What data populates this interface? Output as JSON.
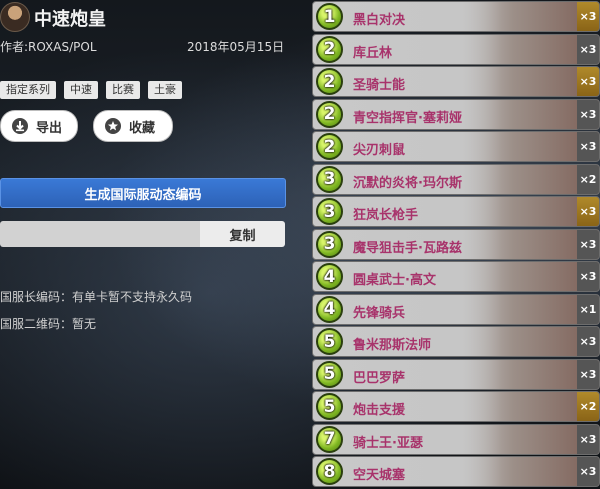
{
  "deck": {
    "title": "中速炮皇",
    "author": "作者:ROXAS/POL",
    "date": "2018年05月15日",
    "tags": [
      "指定系列",
      "中速",
      "比赛",
      "土豪"
    ]
  },
  "actions": {
    "export_label": "导出",
    "favorite_label": "收藏",
    "generate_label": "生成国际服动态编码",
    "copy_label": "复制",
    "code_value": ""
  },
  "notes": {
    "national_code": "国服长编码：有单卡暂不支持永久码",
    "qr_code": "国服二维码：暂无"
  },
  "cards": [
    {
      "cost": "1",
      "name": "黑白对决",
      "count": "×3",
      "gold": true
    },
    {
      "cost": "2",
      "name": "库丘林",
      "count": "×3",
      "gold": false
    },
    {
      "cost": "2",
      "name": "圣骑士能",
      "count": "×3",
      "gold": true
    },
    {
      "cost": "2",
      "name": "青空指挥官·塞莉娅",
      "count": "×3",
      "gold": false
    },
    {
      "cost": "2",
      "name": "尖刃刺鼠",
      "count": "×3",
      "gold": false
    },
    {
      "cost": "3",
      "name": "沉默的炎将·玛尔斯",
      "count": "×2",
      "gold": false
    },
    {
      "cost": "3",
      "name": "狂岚长枪手",
      "count": "×3",
      "gold": true
    },
    {
      "cost": "3",
      "name": "魔导狙击手·瓦路兹",
      "count": "×3",
      "gold": false
    },
    {
      "cost": "4",
      "name": "圆桌武士·高文",
      "count": "×3",
      "gold": false
    },
    {
      "cost": "4",
      "name": "先锋骑兵",
      "count": "×1",
      "gold": false
    },
    {
      "cost": "5",
      "name": "鲁米那斯法师",
      "count": "×3",
      "gold": false
    },
    {
      "cost": "5",
      "name": "巴巴罗萨",
      "count": "×3",
      "gold": false
    },
    {
      "cost": "5",
      "name": "炮击支援",
      "count": "×2",
      "gold": true
    },
    {
      "cost": "7",
      "name": "骑士王·亚瑟",
      "count": "×3",
      "gold": false
    },
    {
      "cost": "8",
      "name": "空天城塞",
      "count": "×3",
      "gold": false
    }
  ]
}
